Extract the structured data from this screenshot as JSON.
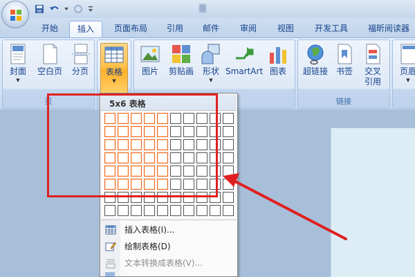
{
  "tabs": [
    "开始",
    "插入",
    "页面布局",
    "引用",
    "邮件",
    "审阅",
    "视图",
    "开发工具",
    "福昕阅读器"
  ],
  "active_tab": "插入",
  "ribbon": {
    "pages_group": {
      "label": "页",
      "buttons": {
        "cover": "封面",
        "blank_page": "空白页",
        "page_break": "分页"
      }
    },
    "tables_group": {
      "table": "表格"
    },
    "illustrations_group": {
      "buttons": {
        "picture": "图片",
        "clipart": "剪贴画",
        "shapes": "形状",
        "smartart": "SmartArt",
        "chart": "图表"
      }
    },
    "links_group": {
      "label": "链接",
      "buttons": {
        "hyperlink": "超链接",
        "bookmark": "书签",
        "cross_ref_1": "交叉",
        "cross_ref_2": "引用"
      }
    },
    "header_footer_group": {
      "header": "页眉"
    }
  },
  "dropdown": {
    "grid_size": "5x6 表格",
    "grid": {
      "columns": 10,
      "rows": 8,
      "highlight_columns": 5,
      "highlight_rows": 6
    },
    "menu": {
      "insert_table": "插入表格(I)...",
      "draw_table": "绘制表格(D)",
      "convert_text": "文本转换成表格(V)..."
    }
  },
  "colors": {
    "highlight_cell": "#f26522",
    "annotation": "#e02020",
    "selected_button": "#ffc14e"
  }
}
